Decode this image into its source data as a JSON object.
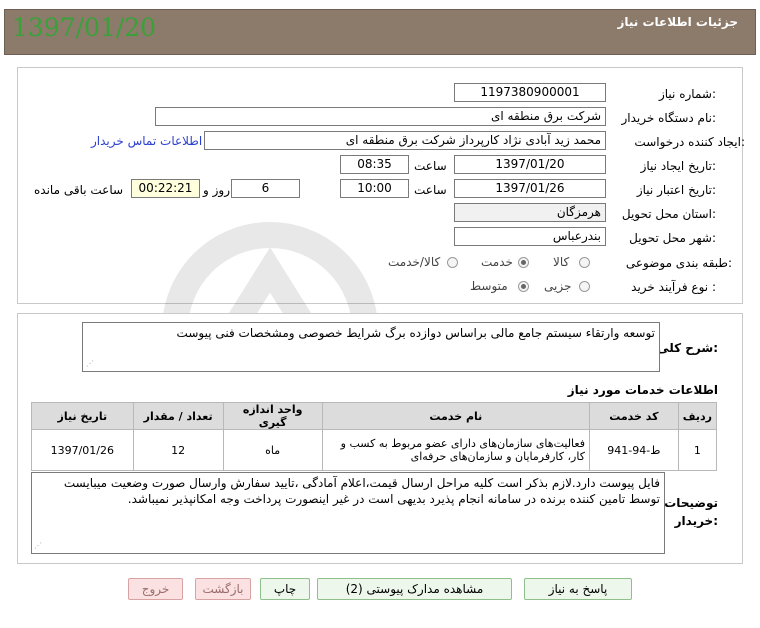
{
  "header": {
    "title": "جزئیات اطلاعات نیاز",
    "date_overlay": "1397/01/20"
  },
  "form": {
    "need_number": {
      "label": "شماره نیاز:",
      "value": "1197380900001"
    },
    "buyer_org": {
      "label": "نام دستگاه خریدار:",
      "value": "شرکت برق منطقه ای"
    },
    "requester": {
      "label": "ایجاد کننده درخواست:",
      "value": "محمد زید آبادی نژاد کارپرداز شرکت برق منطقه ای",
      "contact_link": "اطلاعات تماس خریدار"
    },
    "created": {
      "label": "تاریخ ایجاد نیاز:",
      "date": "1397/01/20",
      "time_label": "ساعت",
      "time": "08:35"
    },
    "deadline": {
      "label": "تاریخ اعتبار نیاز:",
      "date": "1397/01/26",
      "time_label": "ساعت",
      "time": "10:00",
      "days": "6",
      "days_label": "روز و",
      "remaining": "00:22:21",
      "remaining_label": "ساعت باقی مانده"
    },
    "province": {
      "label": "استان محل تحویل:",
      "value": "هرمزگان"
    },
    "city": {
      "label": "شهر محل تحویل:",
      "value": "بندرعباس"
    },
    "category": {
      "label": "طبقه بندی موضوعی:",
      "options": [
        "کالا",
        "خدمت",
        "کالا/خدمت"
      ],
      "selected": "خدمت"
    },
    "process": {
      "label": "نوع فرآیند خرید :",
      "options": [
        "جزیی",
        "متوسط"
      ],
      "selected": "متوسط"
    }
  },
  "summary": {
    "label": "شرح کلی نیاز:",
    "value": "توسعه وارتقاء سیستم جامع مالی براساس دوازده برگ شرایط خصوصی ومشخصات فنی پیوست"
  },
  "services": {
    "title": "اطلاعات خدمات مورد نیاز",
    "headers": [
      "ردیف",
      "کد خدمت",
      "نام خدمت",
      "واحد اندازه گیری",
      "تعداد / مقدار",
      "تاریخ نیاز"
    ],
    "rows": [
      {
        "row": "1",
        "code": "ط-94-941",
        "name": "فعالیت‌های سازمان‌های دارای عضو مربوط به کسب و کار، کارفرمایان و سازمان‌های حرفه‌ای",
        "unit": "ماه",
        "qty": "12",
        "date": "1397/01/26"
      }
    ]
  },
  "buyer_notes": {
    "label": "توضیحات خریدار:",
    "value": "فایل پیوست دارد.لازم بذکر است کلیه مراحل ارسال قیمت،اعلام آمادگی ،تایید سفارش وارسال صورت وضعیت میبایست توسط تامین کننده برنده در سامانه انجام پذیرد بدیهی است در غیر اینصورت پرداخت وجه امکانپذیر نمیباشد."
  },
  "buttons": {
    "reply": "پاسخ به نیاز",
    "view_docs": "مشاهده مدارک پیوستی (2)",
    "print": "چاپ",
    "back": "بازگشت",
    "exit": "خروج"
  },
  "colors": {
    "header_bg": "#8c7b6b",
    "date_overlay": "#3aa13a",
    "link": "#2b3fd0"
  }
}
